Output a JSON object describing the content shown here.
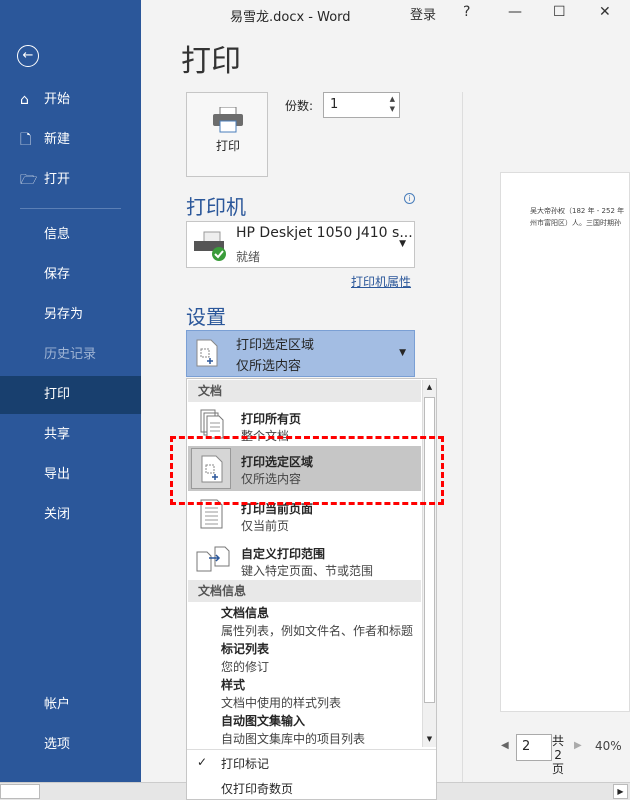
{
  "window": {
    "title": "易雪龙.docx  -  Word",
    "signin": "登录",
    "help": "?",
    "minimize": "—",
    "maximize": "☐",
    "close": "✕"
  },
  "sidebar": {
    "back": "←",
    "items": [
      {
        "label": "开始",
        "icon": "home-icon",
        "glyph": "⌂"
      },
      {
        "label": "新建",
        "icon": "new-document-icon",
        "glyph": "🗋"
      },
      {
        "label": "打开",
        "icon": "open-folder-icon",
        "glyph": "🗁"
      },
      {
        "label": "信息"
      },
      {
        "label": "保存"
      },
      {
        "label": "另存为"
      },
      {
        "label": "历史记录"
      },
      {
        "label": "打印"
      },
      {
        "label": "共享"
      },
      {
        "label": "导出"
      },
      {
        "label": "关闭"
      },
      {
        "label": "帐户"
      },
      {
        "label": "选项"
      }
    ]
  },
  "print": {
    "title": "打印",
    "button": "打印",
    "copies_label": "份数:",
    "copies": "1",
    "printer_heading": "打印机",
    "printer_name": "HP Deskjet 1050 J410 s...",
    "printer_status": "就绪",
    "printer_properties": "打印机属性",
    "settings_heading": "设置",
    "selected_title": "打印选定区域",
    "selected_sub": "仅所选内容"
  },
  "menu": {
    "section1": "文档",
    "items": [
      {
        "title": "打印所有页",
        "sub": "整个文档"
      },
      {
        "title": "打印选定区域",
        "sub": "仅所选内容"
      },
      {
        "title": "打印当前页面",
        "sub": "仅当前页"
      },
      {
        "title": "自定义打印范围",
        "sub": "键入特定页面、节或范围"
      }
    ],
    "section2": "文档信息",
    "info": [
      {
        "title": "文档信息",
        "sub": "属性列表，例如文件名、作者和标题"
      },
      {
        "title": "标记列表",
        "sub": "您的修订"
      },
      {
        "title": "样式",
        "sub": "文档中使用的样式列表"
      },
      {
        "title": "自动图文集输入",
        "sub": "自动图文集库中的项目列表"
      }
    ],
    "print_markup": "打印标记",
    "odd_pages": "仅打印奇数页"
  },
  "preview": {
    "line1": "吴大帝孙权（182 年 - 252 年",
    "line2": "州市富阳区）人。三国时期孙",
    "page": "2",
    "total_a": "共",
    "total_b": "2",
    "total_c": "页",
    "zoom": "40%"
  },
  "colors": {
    "sidebar": "#2b579a",
    "selected_setting": "#a3bde3",
    "highlight": "#ff0000"
  }
}
